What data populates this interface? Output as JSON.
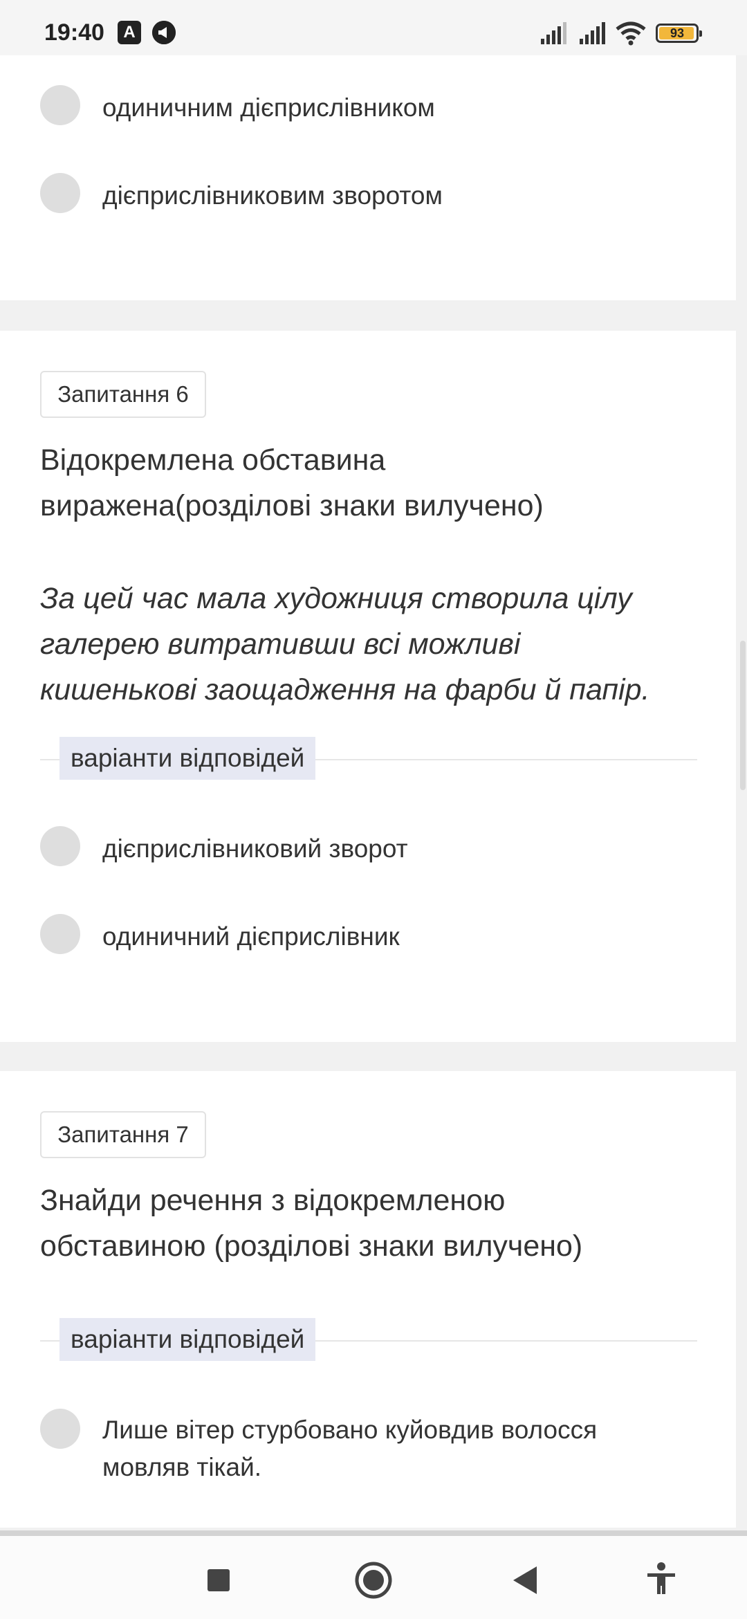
{
  "status_bar": {
    "time": "19:40",
    "battery_level": "93",
    "icons": [
      "text-a-icon",
      "megaphone-icon",
      "signal-icon",
      "signal-icon",
      "wifi-icon",
      "battery-icon"
    ]
  },
  "top_card": {
    "options": [
      {
        "label": "одиничним дієприслівником"
      },
      {
        "label": "дієприслівниковим зворотом"
      }
    ]
  },
  "q6": {
    "badge": "Запитання 6",
    "title_line1": "Відокремлена обставина",
    "title_line2": "виражена(розділові знаки вилучено)",
    "text_line1": "За цей час мала художниця створила цілу",
    "text_line2": "галерею витративши всі можливі",
    "text_line3": "кишенькові заощадження на фарби й папір.",
    "variants_label": "варіанти відповідей",
    "options": [
      {
        "label": "дієприслівниковий зворот"
      },
      {
        "label": "одиничний дієприслівник"
      }
    ]
  },
  "q7": {
    "badge": "Запитання 7",
    "title_line1": "Знайди речення з відокремленою",
    "title_line2": "обставиною (розділові знаки вилучено)",
    "variants_label": "варіанти відповідей",
    "options": [
      {
        "label_line1": "Лише вітер стурбовано куйовдив волосся",
        "label_line2": "мовляв тікай."
      }
    ]
  },
  "nav_bar": {
    "buttons": [
      "recents-icon",
      "home-icon",
      "back-icon",
      "accessibility-icon"
    ]
  },
  "colors": {
    "page_background": "#f1f1f1",
    "card_background": "#ffffff",
    "radio": "#dedede",
    "variants_label_bg": "#e6e8f3",
    "battery_fill": "#f2b73b"
  }
}
